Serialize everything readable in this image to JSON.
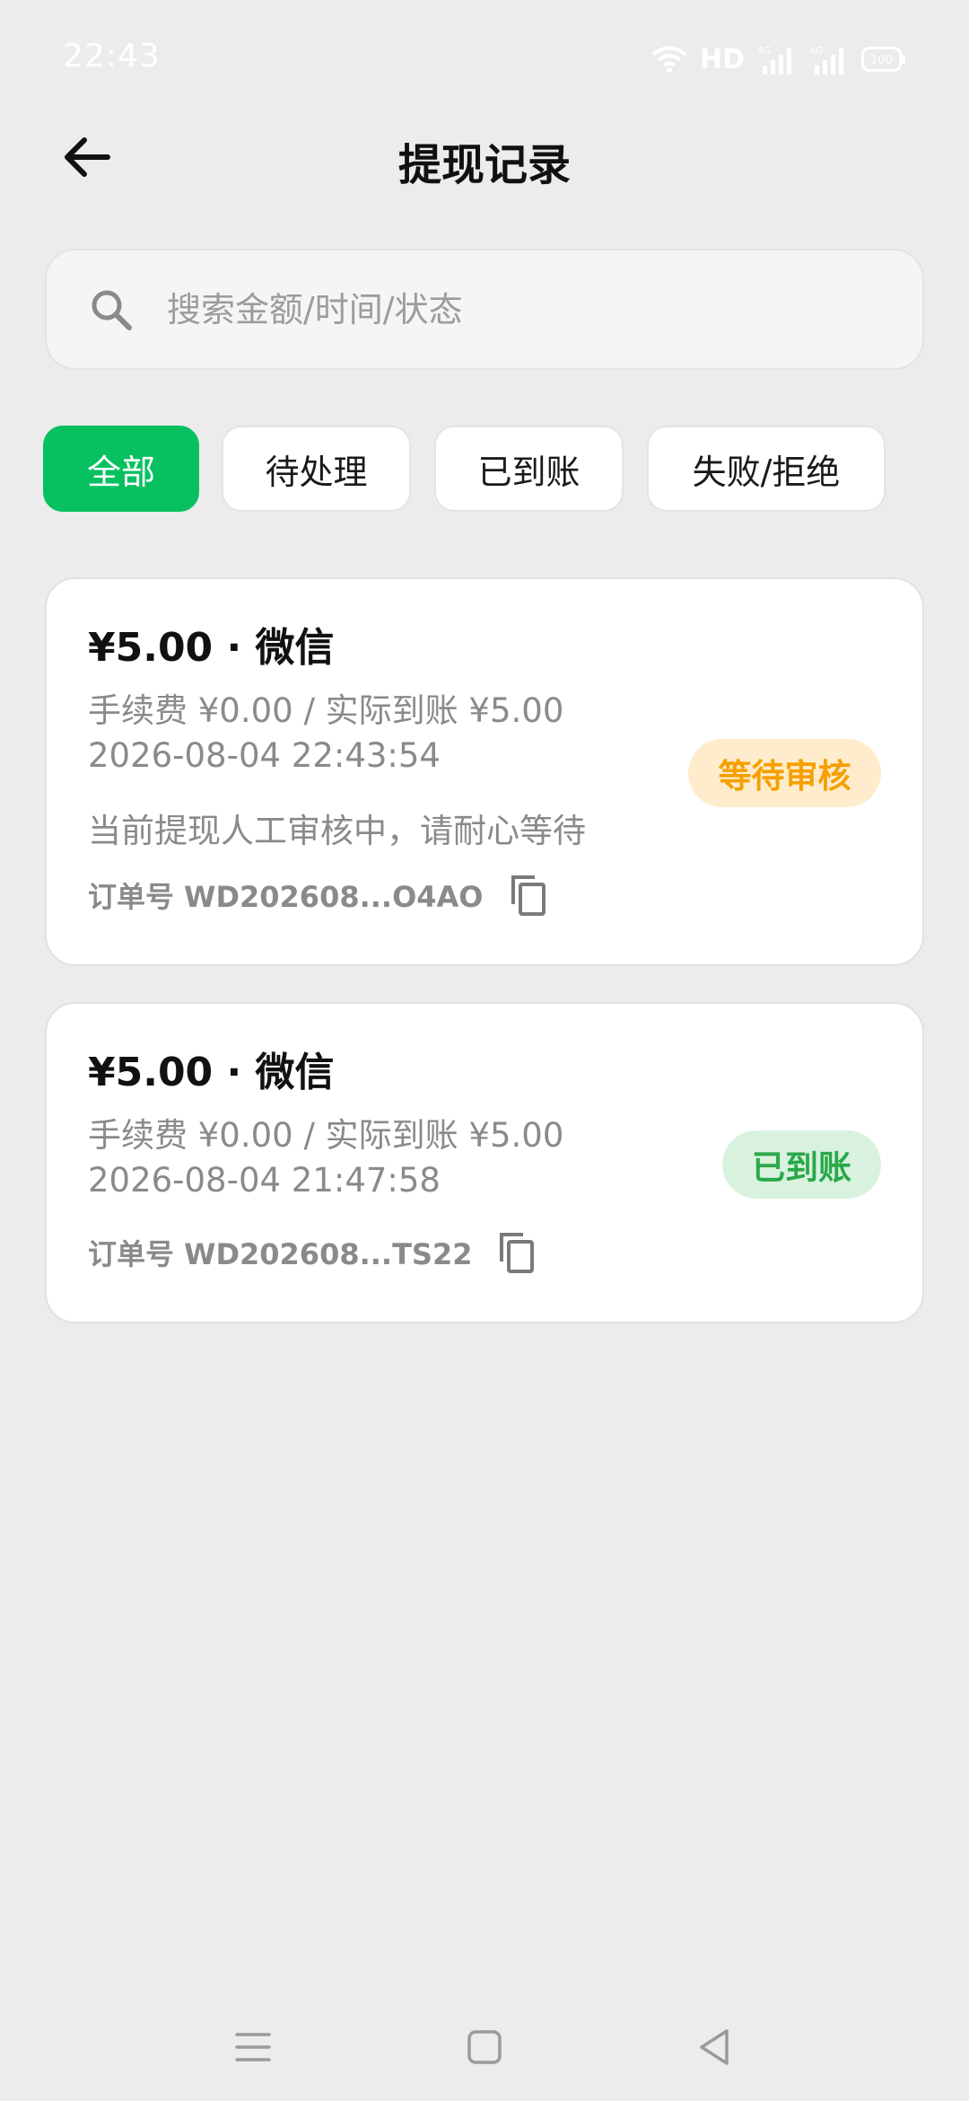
{
  "status_bar": {
    "time": "22:43",
    "network_label": "HD",
    "signal_1": "4G",
    "signal_2": "4G",
    "battery": "100"
  },
  "header": {
    "title": "提现记录"
  },
  "search": {
    "placeholder": "搜索金额/时间/状态",
    "value": ""
  },
  "tabs": [
    {
      "label": "全部",
      "active": true
    },
    {
      "label": "待处理",
      "active": false
    },
    {
      "label": "已到账",
      "active": false
    },
    {
      "label": "失败/拒绝",
      "active": false
    }
  ],
  "records": [
    {
      "title": "¥5.00 · 微信",
      "fee_line": "手续费 ¥0.00 / 实际到账 ¥5.00",
      "time": "2026-08-04 22:43:54",
      "note": "当前提现人工审核中，请耐心等待",
      "order": "订单号 WD202608...O4AO",
      "status": "等待审核",
      "status_color": "#f5a000",
      "status_bg": "#ffeccc"
    },
    {
      "title": "¥5.00 · 微信",
      "fee_line": "手续费 ¥0.00 / 实际到账 ¥5.00",
      "time": "2026-08-04 21:47:58",
      "order": "订单号 WD202608...TS22",
      "status": "已到账",
      "status_color": "#2aa84a",
      "status_bg": "#d9f2df"
    }
  ],
  "colors": {
    "accent": "#07c160",
    "background": "#ececec"
  },
  "icons": {
    "back": "arrow-left-icon",
    "search": "search-icon",
    "copy": "copy-icon",
    "nav_menu": "menu-icon",
    "nav_home": "home-square-icon",
    "nav_back": "triangle-back-icon"
  }
}
